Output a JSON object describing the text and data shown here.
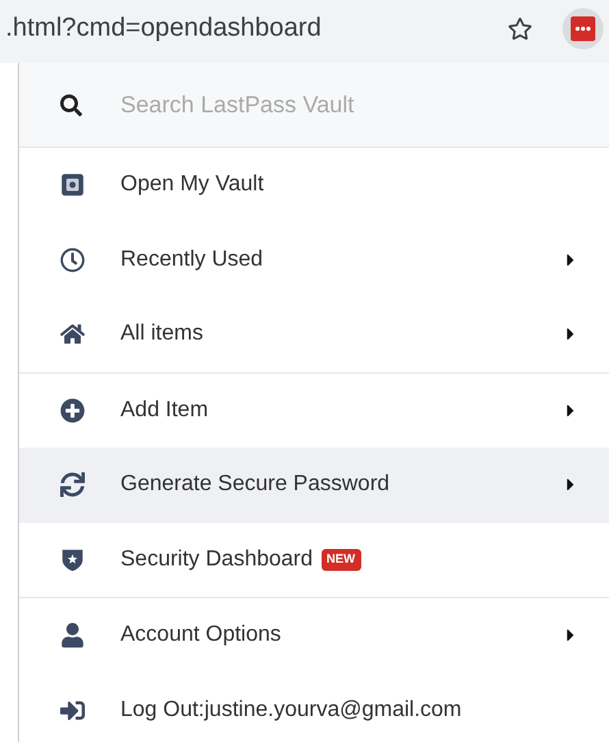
{
  "address_bar": {
    "url": ".html?cmd=opendashboard"
  },
  "search": {
    "placeholder": "Search LastPass Vault"
  },
  "sections": [
    {
      "items": [
        {
          "label": "Open My Vault",
          "submenu": false,
          "selected": false
        },
        {
          "label": "Recently Used",
          "submenu": true,
          "selected": false
        },
        {
          "label": "All items",
          "submenu": true,
          "selected": false
        }
      ]
    },
    {
      "items": [
        {
          "label": "Add Item",
          "submenu": true,
          "selected": false
        },
        {
          "label": "Generate Secure Password",
          "submenu": true,
          "selected": true
        },
        {
          "label": "Security Dashboard",
          "submenu": false,
          "selected": false,
          "badge": "NEW"
        }
      ]
    },
    {
      "items": [
        {
          "label": "Account Options",
          "submenu": true,
          "selected": false
        },
        {
          "label": "Log Out:justine.yourva@gmail.com",
          "submenu": false,
          "selected": false
        }
      ]
    }
  ]
}
